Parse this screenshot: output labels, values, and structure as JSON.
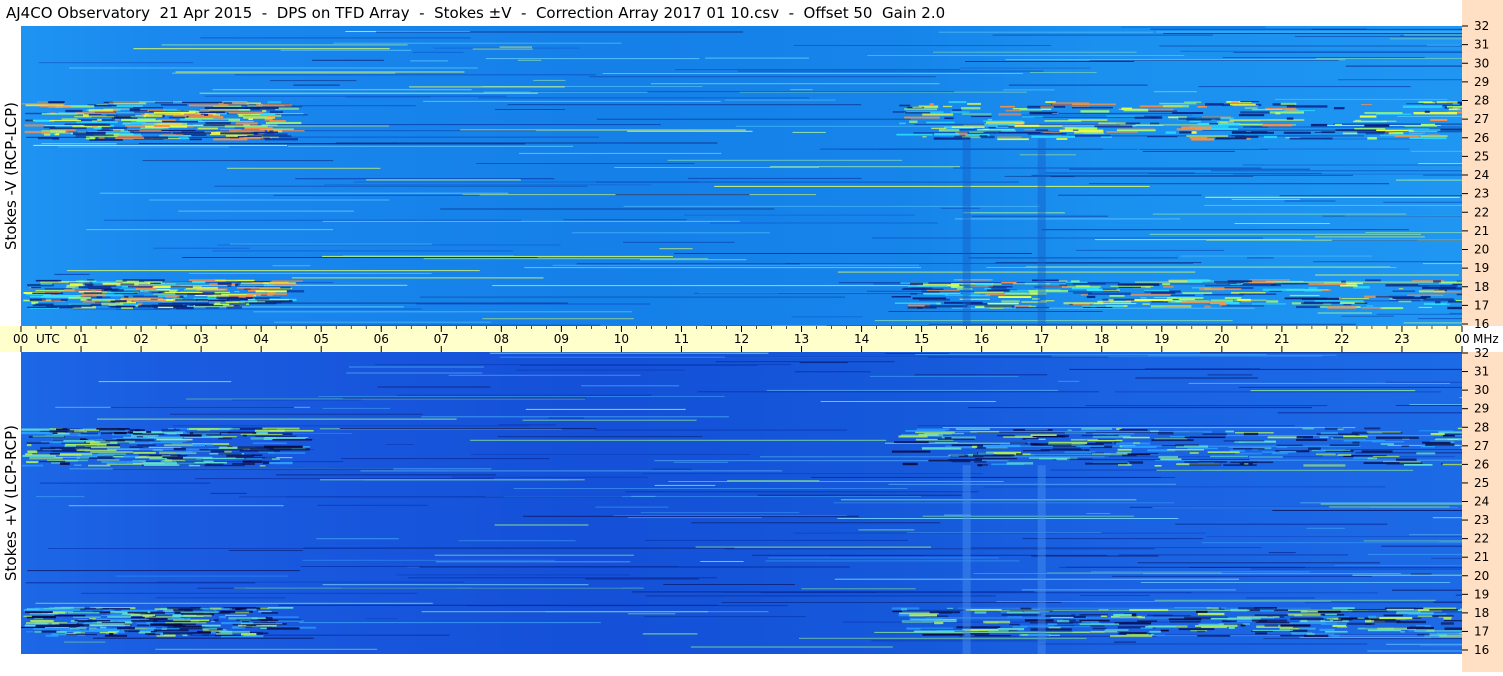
{
  "title": "AJ4CO Observatory  21 Apr 2015  -  DPS on TFD Array  -  Stokes ±V  -  Correction Array 2017 01 10.csv  -  Offset 50  Gain 2.0",
  "chart_data": [
    {
      "type": "heatmap",
      "ylabel": "Stokes -V (RCP-LCP)",
      "x_ticks": [
        "00",
        "01",
        "02",
        "03",
        "04",
        "05",
        "06",
        "07",
        "08",
        "09",
        "10",
        "11",
        "12",
        "13",
        "14",
        "15",
        "16",
        "17",
        "18",
        "19",
        "20",
        "21",
        "22",
        "23",
        "00"
      ],
      "x_unit_start": "UTC",
      "x_range_hours": [
        0,
        24
      ],
      "y_ticks": [
        "16",
        "17",
        "18",
        "19",
        "20",
        "21",
        "22",
        "23",
        "24",
        "25",
        "26",
        "27",
        "28",
        "29",
        "30",
        "31",
        "32"
      ],
      "y_range_mhz": [
        16,
        32
      ],
      "y_unit": "MHz",
      "colormap": [
        "#00007f",
        "#0000ff",
        "#0080ff",
        "#00ffff",
        "#80ff80",
        "#ffff00",
        "#ff8000",
        "#ff0000"
      ],
      "base_color": "#1a8cf0",
      "activity_bands_mhz": [
        [
          26,
          28
        ],
        [
          17,
          18.5
        ]
      ],
      "vertical_streaks_utc": [
        15.75,
        17.0
      ]
    },
    {
      "type": "heatmap",
      "ylabel": "Stokes +V (LCP-RCP)",
      "x_ticks": [
        "00",
        "01",
        "02",
        "03",
        "04",
        "05",
        "06",
        "07",
        "08",
        "09",
        "10",
        "11",
        "12",
        "13",
        "14",
        "15",
        "16",
        "17",
        "18",
        "19",
        "20",
        "21",
        "22",
        "23",
        "00"
      ],
      "x_unit_start": "UTC",
      "x_range_hours": [
        0,
        24
      ],
      "y_ticks": [
        "16",
        "17",
        "18",
        "19",
        "20",
        "21",
        "22",
        "23",
        "24",
        "25",
        "26",
        "27",
        "28",
        "29",
        "30",
        "31",
        "32"
      ],
      "y_range_mhz": [
        16,
        32
      ],
      "y_unit": "MHz",
      "colormap": [
        "#00007f",
        "#0000ff",
        "#0080ff",
        "#00ffff",
        "#80ff80",
        "#ffff00",
        "#ff8000",
        "#ff0000"
      ],
      "base_color": "#1a5fe0",
      "activity_bands_mhz": [
        [
          26,
          28
        ],
        [
          17,
          18.5
        ]
      ],
      "vertical_streaks_utc": [
        15.75,
        17.0
      ]
    }
  ],
  "time_axis": {
    "labels": [
      "00",
      "01",
      "02",
      "03",
      "04",
      "05",
      "06",
      "07",
      "08",
      "09",
      "10",
      "11",
      "12",
      "13",
      "14",
      "15",
      "16",
      "17",
      "18",
      "19",
      "20",
      "21",
      "22",
      "23",
      "00"
    ],
    "utc_label": "UTC",
    "mhz_label": "MHz"
  }
}
